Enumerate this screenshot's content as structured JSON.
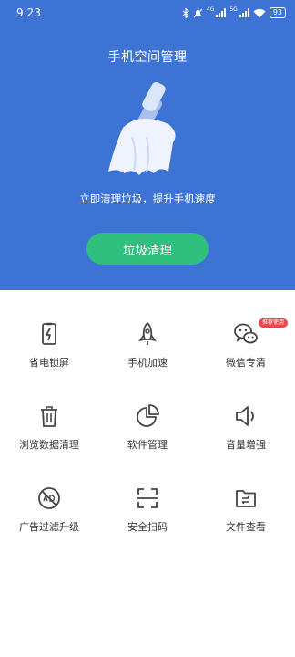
{
  "status_bar": {
    "time": "9:23",
    "network": "4G",
    "network2": "5G",
    "battery": "93"
  },
  "header": {
    "title": "手机空间管理",
    "subtitle": "立即清理垃圾，提升手机速度",
    "clean_button": "垃圾清理"
  },
  "tools": [
    {
      "label": "省电锁屏",
      "icon": "battery-saver-icon"
    },
    {
      "label": "手机加速",
      "icon": "rocket-icon"
    },
    {
      "label": "微信专清",
      "icon": "wechat-icon",
      "badge": "推荐使用"
    },
    {
      "label": "浏览数据清理",
      "icon": "trash-icon"
    },
    {
      "label": "软件管理",
      "icon": "pie-chart-icon"
    },
    {
      "label": "音量增强",
      "icon": "speaker-icon"
    },
    {
      "label": "广告过滤升级",
      "icon": "ad-block-icon"
    },
    {
      "label": "安全扫码",
      "icon": "scan-icon"
    },
    {
      "label": "文件查看",
      "icon": "folder-icon"
    }
  ],
  "colors": {
    "header_bg": "#3e73d6",
    "button_bg": "#2ec07c",
    "badge_bg": "#e84848",
    "icon": "#444444"
  }
}
